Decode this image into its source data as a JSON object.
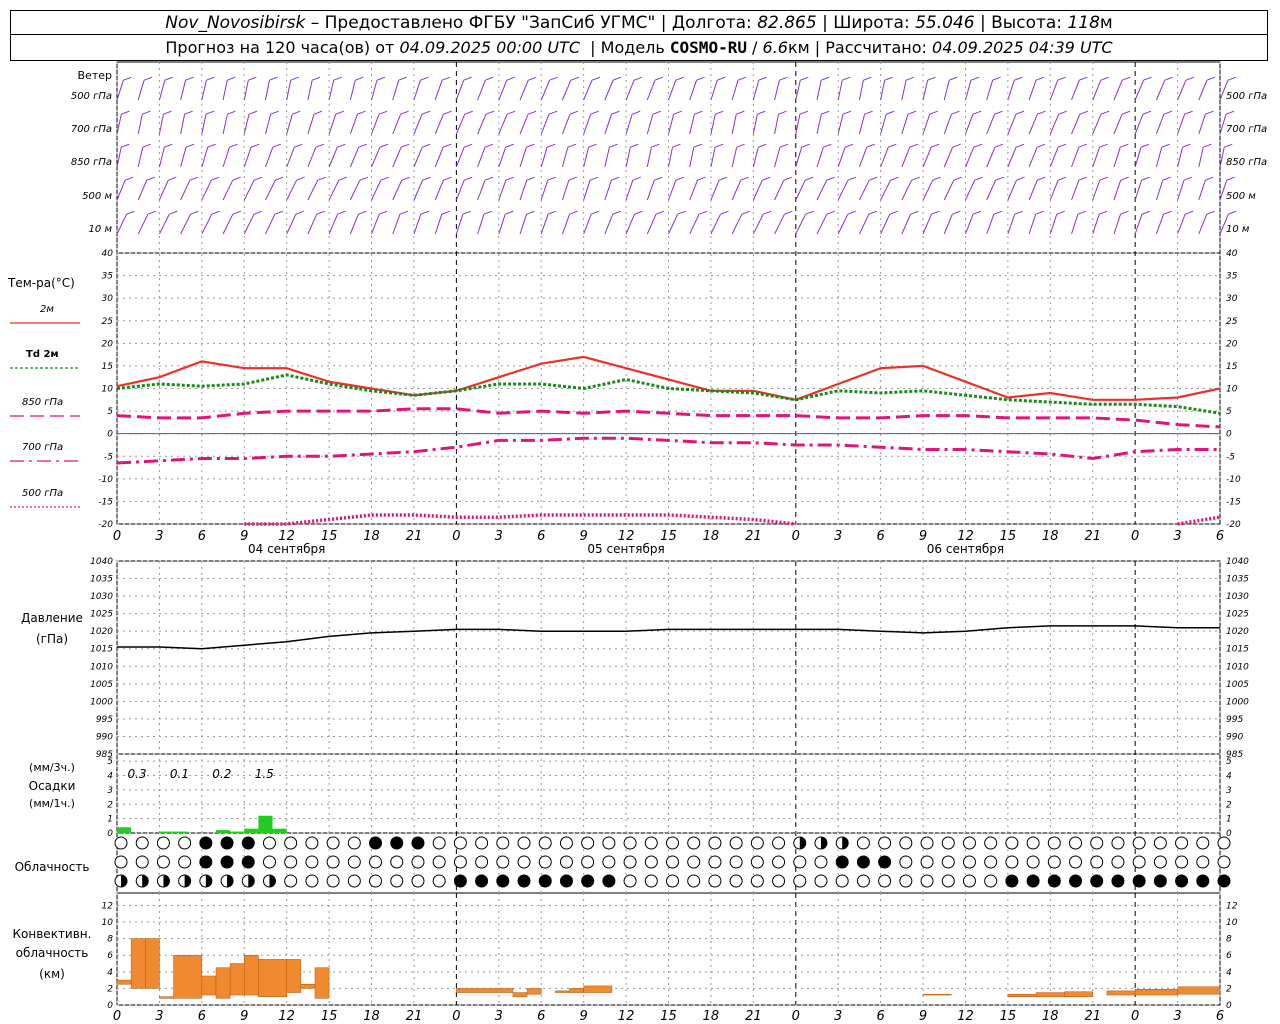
{
  "header": {
    "station": "Nov_Novosibirsk",
    "provider": "– Предоставлено ФГБУ \"ЗапСиб УГМС\"",
    "lon_label": "Долгота:",
    "lon_value": "82.865",
    "lat_label": "Широта:",
    "lat_value": "55.046",
    "alt_label": "Высота:",
    "alt_value": "118",
    "alt_unit": "м",
    "forecast_label": "Прогноз на 120 часа(ов) от",
    "forecast_start": "04.09.2025 00:00 UTC",
    "model_label": "Модель",
    "model_name": "COSMO-RU",
    "model_res": "6.6",
    "model_res_unit": "км",
    "calc_label": "Рассчитано:",
    "calc_time": "04.09.2025 04:39 UTC"
  },
  "time_axis": {
    "tick_labels": [
      "0",
      "3",
      "6",
      "9",
      "12",
      "15",
      "18",
      "21",
      "0",
      "3",
      "6",
      "9",
      "12",
      "15",
      "18",
      "21",
      "0",
      "3",
      "6",
      "9",
      "12",
      "15",
      "18",
      "21",
      "0",
      "3",
      "6"
    ],
    "day_labels": [
      "04 сентября",
      "05 сентября",
      "06 сентября"
    ]
  },
  "wind": {
    "title": "Ветер",
    "levels": [
      "500 гПа",
      "700 гПа",
      "850 гПа",
      "500 м",
      "10 м"
    ],
    "right_levels": [
      "500 гПа",
      "700 гПа",
      "850 гПа",
      "500 м",
      "10 м"
    ],
    "color": "#8a2be2"
  },
  "temperature": {
    "title": "Тем-ра(°C)",
    "legend": [
      {
        "label": "2м",
        "color": "#e8332a",
        "style": "solid"
      },
      {
        "label": "Td  2м",
        "color": "#1a8a1a",
        "style": "dotted"
      },
      {
        "label": "850 гПа",
        "color": "#e0157a",
        "style": "dashed"
      },
      {
        "label": "700 гПа",
        "color": "#e0157a",
        "style": "dashdot"
      },
      {
        "label": "500 гПа",
        "color": "#e0157a",
        "style": "dotted"
      }
    ],
    "y_ticks": [
      "40",
      "35",
      "30",
      "25",
      "20",
      "15",
      "10",
      "5",
      "0",
      "-5",
      "-10",
      "-15",
      "-20"
    ]
  },
  "pressure": {
    "title": "Давление",
    "unit": "(гПа)",
    "y_ticks": [
      "1040",
      "1035",
      "1030",
      "1025",
      "1020",
      "1015",
      "1010",
      "1005",
      "1000",
      "995",
      "990",
      "985"
    ]
  },
  "precip": {
    "unit_top": "(мм/3ч.)",
    "title": "Осадки",
    "unit_bottom": "(мм/1ч.)",
    "y_ticks": [
      "5",
      "4",
      "3",
      "2",
      "1",
      "0"
    ],
    "totals": [
      "0.3",
      "0.1",
      "0.2",
      "1.5"
    ],
    "color": "#22cc22"
  },
  "cloud": {
    "title": "Облачность"
  },
  "convective": {
    "title_line1": "Конвективн.",
    "title_line2": "облачность",
    "unit": "(км)",
    "y_ticks": [
      "12",
      "10",
      "8",
      "6",
      "4",
      "2",
      "0"
    ],
    "color": "#f08a30"
  },
  "chart_data": [
    {
      "type": "line",
      "title": "Тем-ра(°C)",
      "ylim": [
        -20,
        40
      ],
      "x_hours": [
        0,
        3,
        6,
        9,
        12,
        15,
        18,
        21,
        24,
        27,
        30,
        33,
        36,
        39,
        42,
        45,
        48,
        51,
        54,
        57,
        60,
        63,
        66,
        69,
        72,
        75,
        78
      ],
      "series": [
        {
          "name": "2м",
          "values": [
            10.5,
            12.5,
            16,
            14.5,
            14.5,
            11.5,
            10,
            8.5,
            9.5,
            12.5,
            15.5,
            17,
            14.5,
            12,
            9.5,
            9.5,
            7.5,
            11,
            14.5,
            15,
            11.5,
            8,
            9,
            7.5,
            7.5,
            8,
            10
          ]
        },
        {
          "name": "Td  2м",
          "values": [
            10,
            11,
            10.5,
            11,
            13,
            11,
            9.5,
            8.5,
            9.5,
            11,
            11,
            10,
            12,
            10,
            9.5,
            9,
            7.5,
            9.5,
            9,
            9.5,
            8.5,
            7.5,
            7,
            6.5,
            6.5,
            6,
            4.5
          ]
        },
        {
          "name": "850 гПа",
          "values": [
            4,
            3.5,
            3.5,
            4.5,
            5,
            5,
            5,
            5.5,
            5.5,
            4.5,
            5,
            4.5,
            5,
            4.5,
            4,
            4,
            4,
            3.5,
            3.5,
            4,
            4,
            3.5,
            3.5,
            3.5,
            3,
            2,
            1.5
          ]
        },
        {
          "name": "700 гПа",
          "values": [
            -6.5,
            -6,
            -5.5,
            -5.5,
            -5,
            -5,
            -4.5,
            -4,
            -3,
            -1.5,
            -1.5,
            -1,
            -1,
            -1.5,
            -2,
            -2,
            -2.5,
            -2.5,
            -3,
            -3.5,
            -3.5,
            -4,
            -4.5,
            -5.5,
            -4,
            -3.5,
            -3.5
          ]
        },
        {
          "name": "500 гПа",
          "values": [
            null,
            null,
            null,
            -20,
            -20,
            -19,
            -18,
            -18,
            -18.5,
            -18.5,
            -18,
            -18,
            -18,
            -18,
            -18.5,
            -19,
            -20,
            null,
            null,
            null,
            null,
            null,
            null,
            null,
            null,
            -20,
            -18.5
          ]
        }
      ]
    },
    {
      "type": "line",
      "title": "Давление",
      "ylim": [
        985,
        1040
      ],
      "x_hours": [
        0,
        3,
        6,
        9,
        12,
        15,
        18,
        21,
        24,
        27,
        30,
        33,
        36,
        39,
        42,
        45,
        48,
        51,
        54,
        57,
        60,
        63,
        66,
        69,
        72,
        75,
        78
      ],
      "series": [
        {
          "name": "Давление",
          "values": [
            1015.5,
            1015.5,
            1015,
            1016,
            1017,
            1018.5,
            1019.5,
            1020,
            1020.5,
            1020.5,
            1020,
            1020,
            1020,
            1020.5,
            1020.5,
            1020.5,
            1020.5,
            1020.5,
            1020,
            1019.5,
            1020,
            1021,
            1021.5,
            1021.5,
            1021.5,
            1021,
            1021
          ]
        }
      ]
    },
    {
      "type": "bar",
      "title": "Осадки",
      "ylim": [
        0,
        5
      ],
      "x_hours": [
        0,
        3,
        6,
        9
      ],
      "labels": [
        "0.3",
        "0.1",
        "0.2",
        "1.5"
      ],
      "bars_1h": [
        {
          "hour": 0,
          "value": 0.4
        },
        {
          "hour": 3,
          "value": 0.1
        },
        {
          "hour": 4,
          "value": 0.1
        },
        {
          "hour": 7,
          "value": 0.2
        },
        {
          "hour": 8,
          "value": 0.1
        },
        {
          "hour": 9,
          "value": 0.3
        },
        {
          "hour": 10,
          "value": 1.2
        },
        {
          "hour": 11,
          "value": 0.3
        }
      ]
    },
    {
      "type": "bar",
      "title": "Конвективн. облачность",
      "ylim": [
        0,
        13
      ],
      "ranges_km": [
        {
          "h0": 0,
          "h1": 1,
          "lo": 2.5,
          "hi": 3
        },
        {
          "h0": 1,
          "h1": 2,
          "lo": 2,
          "hi": 8
        },
        {
          "h0": 2,
          "h1": 3,
          "lo": 2,
          "hi": 8
        },
        {
          "h0": 3,
          "h1": 4,
          "lo": 0.8,
          "hi": 1
        },
        {
          "h0": 4,
          "h1": 6,
          "lo": 0.8,
          "hi": 6
        },
        {
          "h0": 6,
          "h1": 7,
          "lo": 1.2,
          "hi": 3.5
        },
        {
          "h0": 7,
          "h1": 8,
          "lo": 0.8,
          "hi": 4.5
        },
        {
          "h0": 8,
          "h1": 9,
          "lo": 1.2,
          "hi": 5
        },
        {
          "h0": 9,
          "h1": 10,
          "lo": 1.2,
          "hi": 6
        },
        {
          "h0": 10,
          "h1": 12,
          "lo": 1,
          "hi": 5.5
        },
        {
          "h0": 12,
          "h1": 13,
          "lo": 1.5,
          "hi": 5.5
        },
        {
          "h0": 13,
          "h1": 14,
          "lo": 2,
          "hi": 2.5
        },
        {
          "h0": 14,
          "h1": 15,
          "lo": 0.8,
          "hi": 4.5
        },
        {
          "h0": 24,
          "h1": 28,
          "lo": 1.5,
          "hi": 2
        },
        {
          "h0": 28,
          "h1": 29,
          "lo": 1,
          "hi": 1.5
        },
        {
          "h0": 29,
          "h1": 30,
          "lo": 1.3,
          "hi": 2
        },
        {
          "h0": 31,
          "h1": 32,
          "lo": 1.5,
          "hi": 1.7
        },
        {
          "h0": 32,
          "h1": 33,
          "lo": 1.5,
          "hi": 2
        },
        {
          "h0": 33,
          "h1": 35,
          "lo": 1.5,
          "hi": 2.3
        },
        {
          "h0": 57,
          "h1": 59,
          "lo": 1.2,
          "hi": 1.3
        },
        {
          "h0": 63,
          "h1": 65,
          "lo": 1,
          "hi": 1.3
        },
        {
          "h0": 65,
          "h1": 67,
          "lo": 1,
          "hi": 1.5
        },
        {
          "h0": 67,
          "h1": 69,
          "lo": 1,
          "hi": 1.6
        },
        {
          "h0": 70,
          "h1": 72,
          "lo": 1.2,
          "hi": 1.7
        },
        {
          "h0": 72,
          "h1": 75,
          "lo": 1.2,
          "hi": 1.9
        },
        {
          "h0": 75,
          "h1": 78,
          "lo": 1.3,
          "hi": 2.2
        }
      ]
    }
  ]
}
